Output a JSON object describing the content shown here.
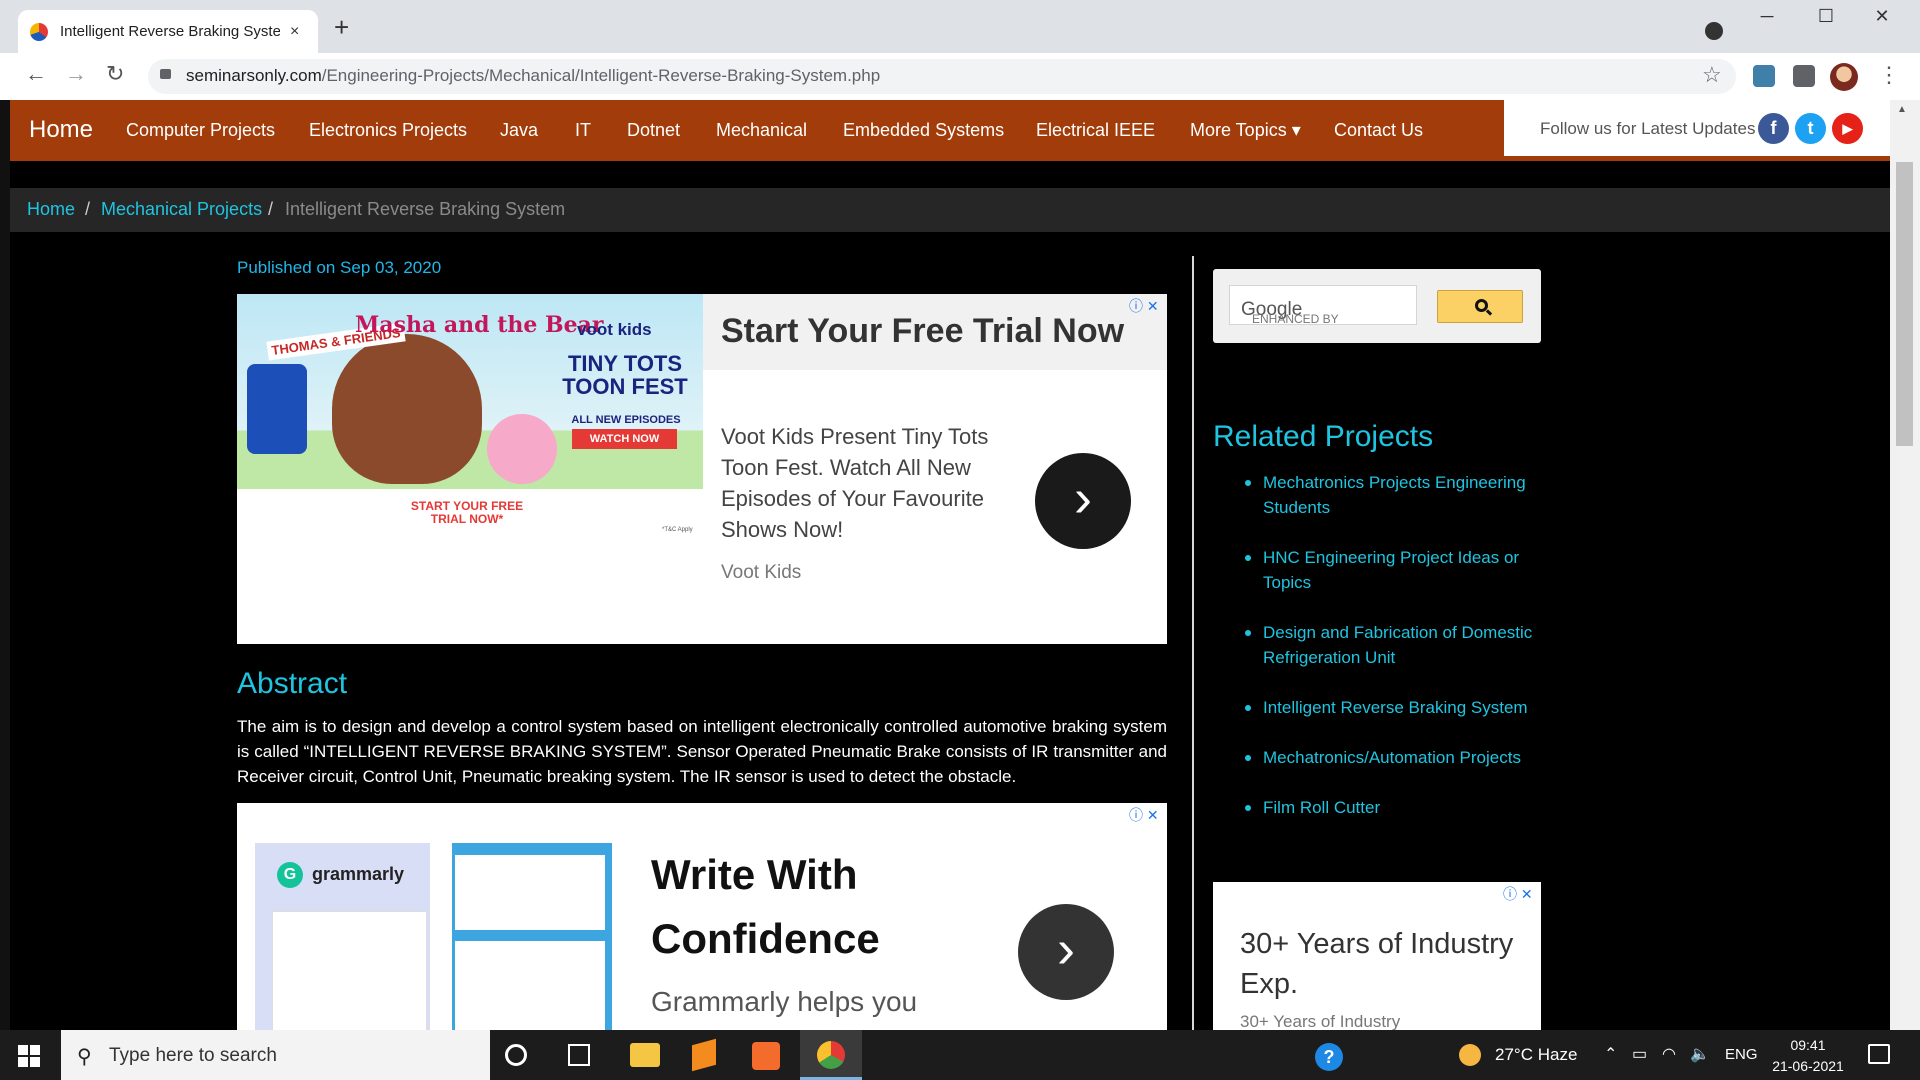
{
  "browser": {
    "tab_title": "Intelligent Reverse Braking Syste",
    "tab_close": "×",
    "new_tab": "+",
    "url_domain": "seminarsonly.com",
    "url_path": "/Engineering-Projects/Mechanical/Intelligent-Reverse-Braking-System.php",
    "window_controls": {
      "minimize": "─",
      "maximize": "☐",
      "close": "✕"
    },
    "nav": {
      "back": "←",
      "forward": "→",
      "reload": "↻"
    },
    "star": "☆",
    "menu": "⋮"
  },
  "site_nav": {
    "brand": "Home",
    "links": [
      "Computer Projects",
      "Electronics Projects",
      "Java",
      "IT",
      "Dotnet",
      "Mechanical",
      "Embedded Systems",
      "Electrical IEEE",
      "More Topics ▾",
      "Contact Us"
    ],
    "follow_label": "Follow us for Latest Updates",
    "social": {
      "facebook": "f",
      "twitter": "t",
      "youtube": "▶"
    },
    "colors": {
      "nav_bg": "#a23c0a",
      "facebook": "#3b5998",
      "twitter": "#1da1f2",
      "youtube": "#e62117"
    }
  },
  "breadcrumb": {
    "home": "Home",
    "sep1": "/",
    "section": "Mechanical Projects",
    "sep2": "/",
    "current": "Intelligent Reverse Braking System"
  },
  "article": {
    "published": "Published on Sep 03, 2020",
    "abstract_heading": "Abstract",
    "abstract_text": "The aim is to design and develop a control system based on intelligent electronically controlled automotive braking system is called “INTELLIGENT REVERSE BRAKING SYSTEM”. Sensor Operated Pneumatic Brake consists of IR transmitter and Receiver circuit, Control Unit, Pneumatic breaking system. The IR sensor is used to detect the obstacle."
  },
  "ad1": {
    "headline": "Start Your Free Trial Now",
    "body": "Voot Kids Present Tiny Tots Toon Fest. Watch All New Episodes of Your Favourite Shows Now!",
    "advertiser": "Voot Kids",
    "img_thomas": "THOMAS & FRIENDS",
    "img_masha": "Masha and the Bear",
    "img_voot": "voot kids",
    "img_fest": "TINY TOTS TOON FEST",
    "img_episodes": "ALL NEW EPISODES",
    "img_watch": "WATCH NOW",
    "img_trial": "START YOUR FREE TRIAL NOW*",
    "img_tac": "*T&C Apply",
    "arrow": "›",
    "adchoices": "ⓘ ✕"
  },
  "ad2": {
    "brand": "grammarly",
    "brand_initial": "G",
    "headline_line1": "Write With",
    "headline_line2": "Confidence",
    "sub": "Grammarly helps you",
    "arrow": "›",
    "adchoices": "ⓘ ✕"
  },
  "sidebar": {
    "search_label_prefix": "ENHANCED BY",
    "search_label_brand": "Google",
    "related_heading": "Related Projects",
    "related": [
      "Mechatronics Projects Engineering Students",
      "HNC Engineering Project Ideas or Topics",
      "Design and Fabrication of Domestic Refrigeration Unit",
      "Intelligent Reverse Braking System",
      "Mechatronics/Automation Projects",
      "Film Roll Cutter"
    ],
    "ad3_headline": "30+ Years of Industry Exp.",
    "ad3_sub": "30+ Years of Industry",
    "ad3_adchoices": "ⓘ ✕"
  },
  "taskbar": {
    "search_placeholder": "Type here to search",
    "search_icon": "⚲",
    "help": "?",
    "weather": "27°C  Haze",
    "tray_up": "⌃",
    "tray_battery": "▭",
    "tray_wifi": "◠",
    "tray_volume": "🔈",
    "lang": "ENG",
    "time": "09:41",
    "date": "21-06-2021"
  }
}
